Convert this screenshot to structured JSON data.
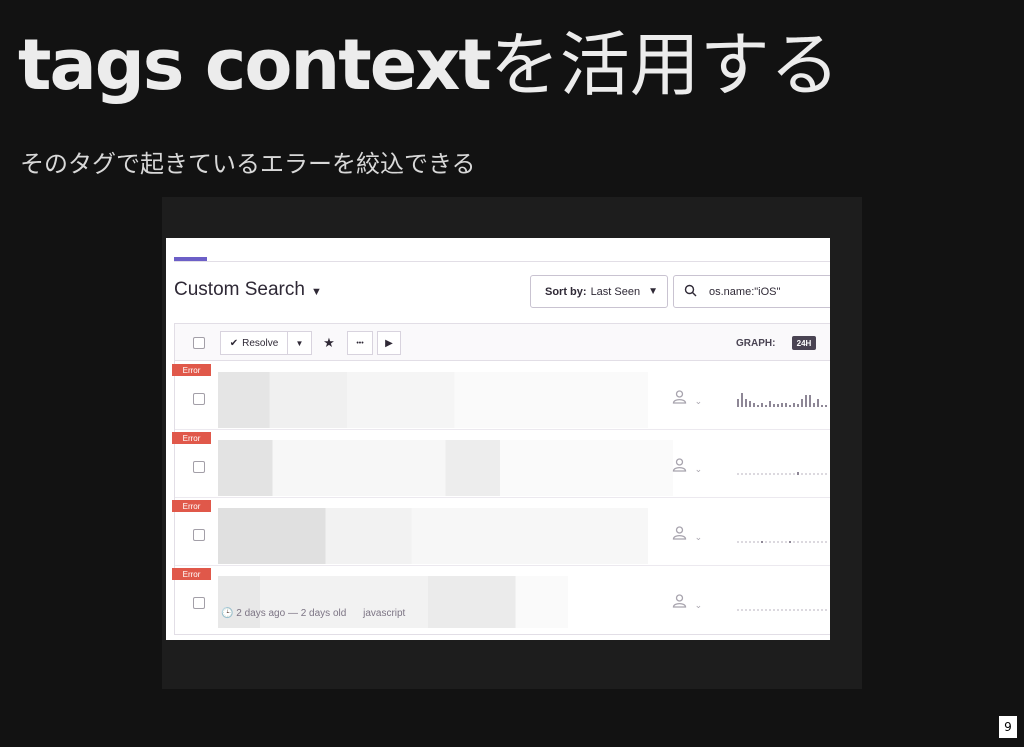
{
  "slide": {
    "title_latin": "tags context",
    "title_jp": "を活用する",
    "subtitle": "そのタグで起きているエラーを絞込できる",
    "page_number": "9"
  },
  "screenshot": {
    "header": {
      "title": "Custom Search",
      "title_chevron": "⌄",
      "sort_label": "Sort by:",
      "sort_value": "Last Seen",
      "search_value": "os.name:\"iOS\""
    },
    "toolbar": {
      "resolve_label": "Resolve",
      "more_label": "•••",
      "graph_label": "GRAPH:",
      "graph_period": "24H"
    },
    "issues": [
      {
        "level": "Error"
      },
      {
        "level": "Error"
      },
      {
        "level": "Error"
      },
      {
        "level": "Error"
      }
    ],
    "last_issue_meta": {
      "age": "2 days ago — 2 days old",
      "platform": "javascript"
    },
    "colors": {
      "accent": "#6c5fc7",
      "error": "#e0584a",
      "background": "#121212"
    }
  }
}
